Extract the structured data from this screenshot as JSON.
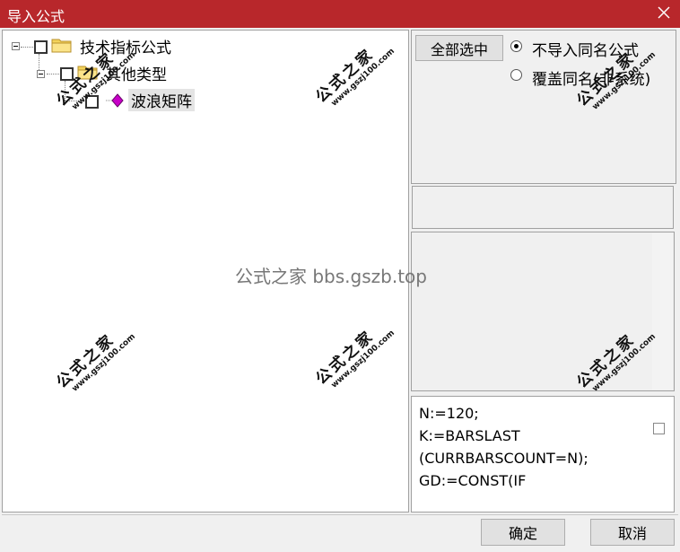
{
  "window": {
    "title": "导入公式",
    "close_icon": "close-icon"
  },
  "tree": {
    "root": {
      "label": "技术指标公式",
      "icon": "folder-icon"
    },
    "group": {
      "label": "其他类型",
      "icon": "folder-icon"
    },
    "item": {
      "label": "波浪矩阵",
      "icon": "formula-diamond-icon"
    }
  },
  "right_panel": {
    "select_all_label": "全部选中",
    "option_no_import": "不导入同名公式",
    "option_overwrite": "覆盖同名(非系统)"
  },
  "code_preview": {
    "lines": [
      "N:=120;",
      "K:=BARSLAST",
      "(CURRBARSCOUNT=N);",
      "GD:=CONST(IF"
    ]
  },
  "buttons": {
    "ok_label": "确定",
    "cancel_label": "取消"
  },
  "watermark": {
    "chinese": "公式之家",
    "url": "www.gszj100.com",
    "center_text": "公式之家 bbs.gszb.top"
  },
  "colors": {
    "titlebar": "#b8272b",
    "window_bg": "#f0f0f0",
    "diamond": "#c800c8"
  }
}
